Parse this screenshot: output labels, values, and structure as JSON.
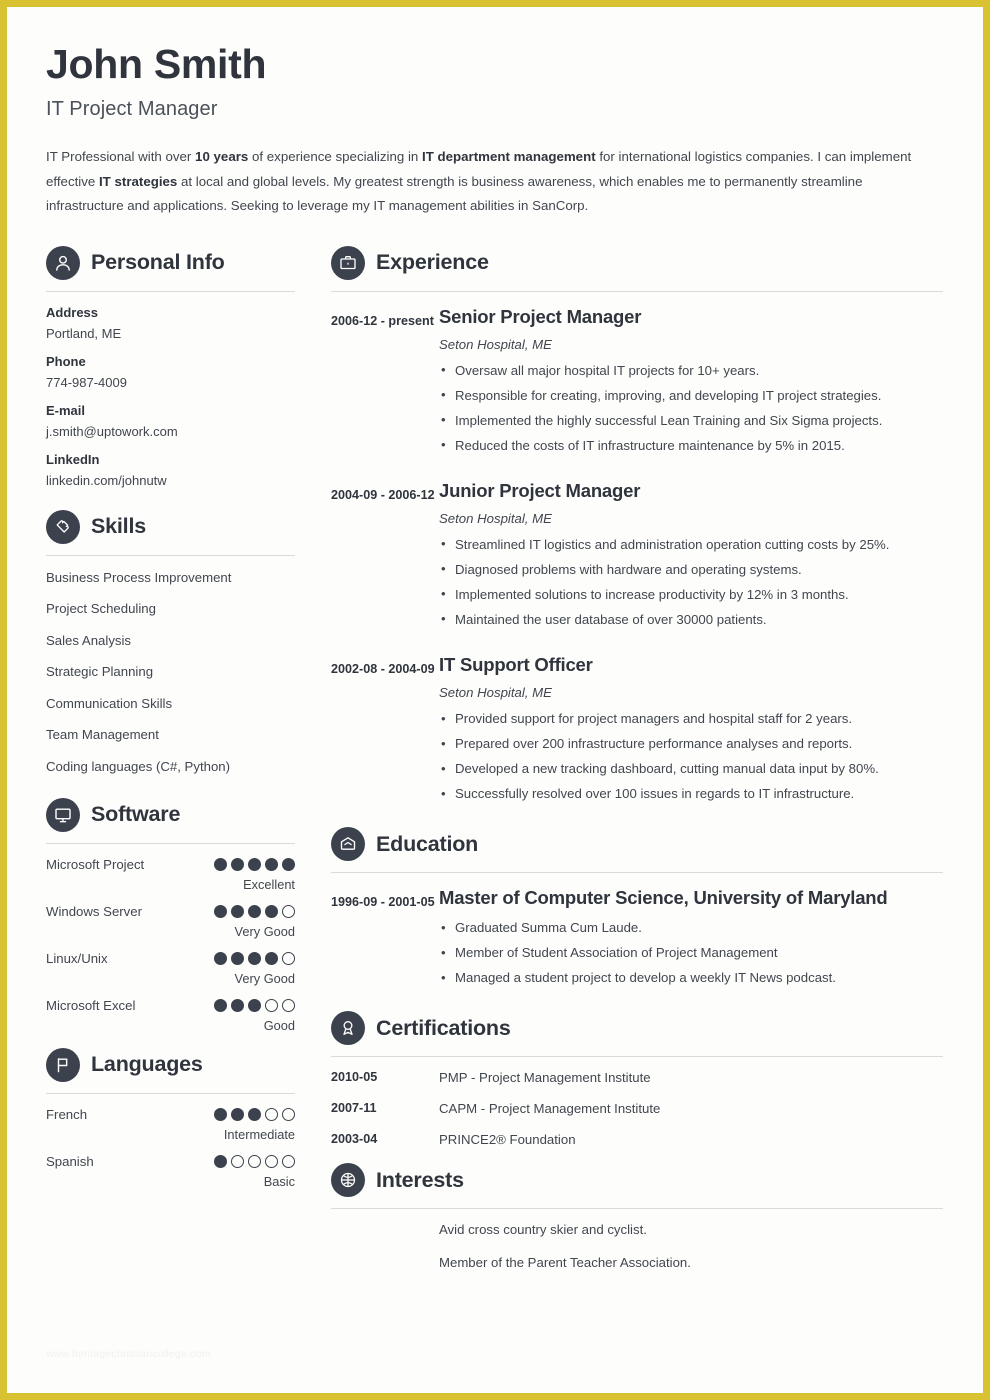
{
  "theme": {
    "border_color": "#d9c231",
    "icon_bg": "#3c424d",
    "heading_color": "#2f343d",
    "body_color": "#41464e",
    "rule_color": "#dadada"
  },
  "header": {
    "name": "John Smith",
    "job_title": "IT Project Manager",
    "summary_parts": [
      {
        "text": "IT Professional with over ",
        "bold": false
      },
      {
        "text": "10 years",
        "bold": true
      },
      {
        "text": " of experience specializing in ",
        "bold": false
      },
      {
        "text": "IT department management",
        "bold": true
      },
      {
        "text": " for international logistics companies. I can implement effective ",
        "bold": false
      },
      {
        "text": "IT strategies",
        "bold": true
      },
      {
        "text": " at local and global levels. My greatest strength is business awareness, which enables me to permanently streamline infrastructure and applications. Seeking to leverage my IT management abilities in SanCorp.",
        "bold": false
      }
    ]
  },
  "personal_info": {
    "title": "Personal Info",
    "icon": "person-icon",
    "fields": [
      {
        "label": "Address",
        "value": "Portland, ME"
      },
      {
        "label": "Phone",
        "value": "774-987-4009"
      },
      {
        "label": "E-mail",
        "value": "j.smith@uptowork.com"
      },
      {
        "label": "LinkedIn",
        "value": "linkedin.com/johnutw"
      }
    ]
  },
  "skills": {
    "title": "Skills",
    "icon": "puzzle-icon",
    "items": [
      "Business Process Improvement",
      "Project Scheduling",
      "Sales Analysis",
      "Strategic Planning",
      "Communication Skills",
      "Team Management",
      "Coding languages (C#, Python)"
    ]
  },
  "software": {
    "title": "Software",
    "icon": "monitor-icon",
    "max_dots": 5,
    "items": [
      {
        "name": "Microsoft Project",
        "filled": 5,
        "level": "Excellent"
      },
      {
        "name": "Windows Server",
        "filled": 4,
        "level": "Very Good"
      },
      {
        "name": "Linux/Unix",
        "filled": 4,
        "level": "Very Good"
      },
      {
        "name": "Microsoft Excel",
        "filled": 3,
        "level": "Good"
      }
    ]
  },
  "languages": {
    "title": "Languages",
    "icon": "flag-icon",
    "max_dots": 5,
    "items": [
      {
        "name": "French",
        "filled": 3,
        "level": "Intermediate"
      },
      {
        "name": "Spanish",
        "filled": 1,
        "level": "Basic"
      }
    ]
  },
  "experience": {
    "title": "Experience",
    "icon": "briefcase-icon",
    "entries": [
      {
        "date": "2006-12 - present",
        "title": "Senior Project Manager",
        "subtitle": "Seton Hospital, ME",
        "bullets": [
          "Oversaw all major hospital IT projects for 10+ years.",
          "Responsible for creating, improving, and developing IT project strategies.",
          "Implemented the highly successful Lean Training and Six Sigma projects.",
          "Reduced the costs of IT infrastructure maintenance by 5% in 2015."
        ]
      },
      {
        "date": "2004-09 - 2006-12",
        "title": "Junior Project Manager",
        "subtitle": "Seton Hospital, ME",
        "bullets": [
          "Streamlined IT logistics and administration operation cutting costs by 25%.",
          "Diagnosed problems with hardware and operating systems.",
          "Implemented solutions to increase productivity by 12% in 3 months.",
          "Maintained the user database of over 30000 patients."
        ]
      },
      {
        "date": "2002-08 - 2004-09",
        "title": "IT Support Officer",
        "subtitle": "Seton Hospital, ME",
        "bullets": [
          "Provided support for project managers and hospital staff for 2 years.",
          "Prepared over 200 infrastructure performance analyses and reports.",
          "Developed a new tracking dashboard, cutting manual data input by 80%.",
          "Successfully resolved over 100 issues in regards to IT infrastructure."
        ]
      }
    ]
  },
  "education": {
    "title": "Education",
    "icon": "graduation-cap-icon",
    "entries": [
      {
        "date": "1996-09 - 2001-05",
        "title": "Master of Computer Science, University of Maryland",
        "bullets": [
          "Graduated Summa Cum Laude.",
          "Member of Student Association of Project Management",
          "Managed a student project to develop a weekly IT News podcast."
        ]
      }
    ]
  },
  "certifications": {
    "title": "Certifications",
    "icon": "award-ribbon-icon",
    "rows": [
      {
        "date": "2010-05",
        "text": "PMP - Project Management Institute"
      },
      {
        "date": "2007-11",
        "text": "CAPM - Project Management Institute"
      },
      {
        "date": "2003-04",
        "text": "PRINCE2® Foundation"
      }
    ]
  },
  "interests": {
    "title": "Interests",
    "icon": "basketball-icon",
    "items": [
      "Avid cross country skier and cyclist.",
      "Member of the Parent Teacher Association."
    ]
  },
  "watermark": "www.heritagechristiancollege.com"
}
